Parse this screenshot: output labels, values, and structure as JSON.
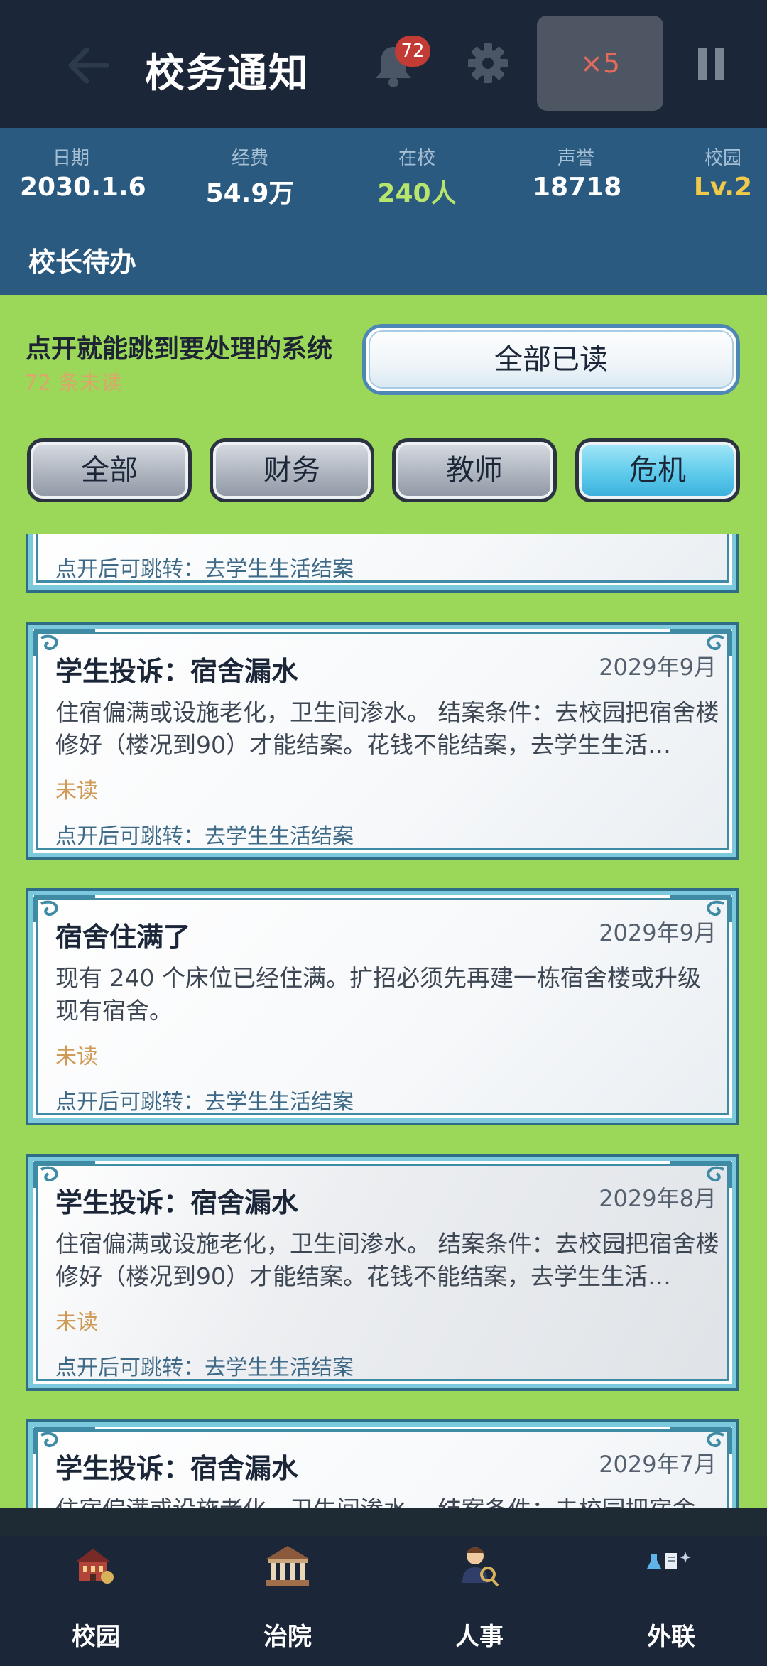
{
  "header": {
    "title": "校务通知",
    "notification_count": "72",
    "speed_label": "×5"
  },
  "stats": [
    {
      "label": "日期",
      "value": "2030.1.6"
    },
    {
      "label": "经费",
      "value": "54.9万"
    },
    {
      "label": "在校",
      "value": "240人"
    },
    {
      "label": "声誉",
      "value": "18718"
    },
    {
      "label": "校园",
      "value": "Lv.2"
    }
  ],
  "section_title": "校长待办",
  "subtitle": "点开就能跳到要处理的系统",
  "unread_summary": "72 条未读",
  "mark_all_read_label": "全部已读",
  "filters": [
    {
      "label": "全部",
      "active": false
    },
    {
      "label": "财务",
      "active": false
    },
    {
      "label": "教师",
      "active": false
    },
    {
      "label": "危机",
      "active": true
    }
  ],
  "notices": [
    {
      "title": "",
      "date": "",
      "body": "",
      "status": "",
      "hint": "点开后可跳转：去学生生活结案"
    },
    {
      "title": "学生投诉：宿舍漏水",
      "date": "2029年9月",
      "body": "住宿偏满或设施老化，卫生间渗水。 结案条件：去校园把宿舍楼修好（楼况到90）才能结案。花钱不能结案，去学生生活…",
      "status": "未读",
      "hint": "点开后可跳转：去学生生活结案"
    },
    {
      "title": "宿舍住满了",
      "date": "2029年9月",
      "body": "现有 240 个床位已经住满。扩招必须先再建一栋宿舍楼或升级现有宿舍。",
      "status": "未读",
      "hint": "点开后可跳转：去学生生活结案"
    },
    {
      "title": "学生投诉：宿舍漏水",
      "date": "2029年8月",
      "body": "住宿偏满或设施老化，卫生间渗水。 结案条件：去校园把宿舍楼修好（楼况到90）才能结案。花钱不能结案，去学生生活…",
      "status": "未读",
      "hint": "点开后可跳转：去学生生活结案"
    },
    {
      "title": "学生投诉：宿舍漏水",
      "date": "2029年7月",
      "body": "住宿偏满或设施老化，卫生间渗水。 结案条件：去校园把宿舍…",
      "status": "",
      "hint": ""
    }
  ],
  "bottom_nav": [
    {
      "label": "校园",
      "icon": "school-building-icon"
    },
    {
      "label": "治院",
      "icon": "classical-hall-icon"
    },
    {
      "label": "人事",
      "icon": "person-magnifier-icon"
    },
    {
      "label": "外联",
      "icon": "flask-document-icon"
    }
  ],
  "colors": {
    "topbar": "#1b2638",
    "statsbar": "#2b5a80",
    "content_bg": "#9bd85a",
    "badge": "#c23b35",
    "speed_text": "#e36a5c",
    "unread": "#cf9a55",
    "active_tab": "#5fcbeb"
  }
}
